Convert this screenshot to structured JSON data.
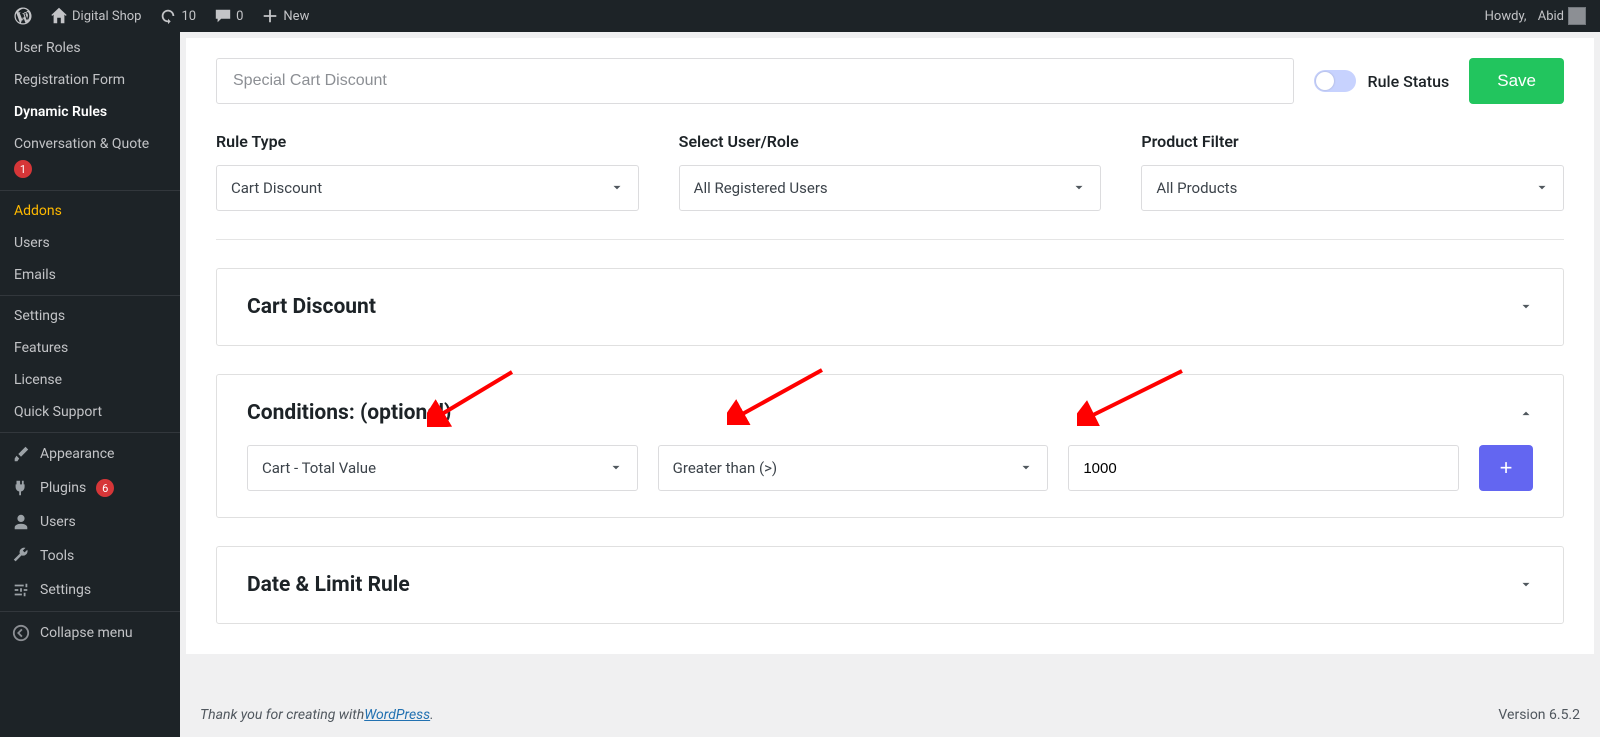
{
  "adminbar": {
    "site_name": "Digital Shop",
    "updates_count": "10",
    "comments_count": "0",
    "new_label": "New",
    "howdy_prefix": "Howdy,",
    "user": "Abid"
  },
  "sidebar": {
    "user_roles": "User Roles",
    "registration_form": "Registration Form",
    "dynamic_rules": "Dynamic Rules",
    "conversation_quote": "Conversation & Quote",
    "conversation_badge": "1",
    "addons": "Addons",
    "users": "Users",
    "emails": "Emails",
    "settings": "Settings",
    "features": "Features",
    "license": "License",
    "quick_support": "Quick Support",
    "appearance": "Appearance",
    "plugins": "Plugins",
    "plugins_badge": "6",
    "wp_users": "Users",
    "tools": "Tools",
    "wp_settings": "Settings",
    "collapse": "Collapse menu"
  },
  "main": {
    "rule_name_placeholder": "Special Cart Discount",
    "rule_status_label": "Rule Status",
    "save_label": "Save",
    "rule_type_label": "Rule Type",
    "rule_type_value": "Cart Discount",
    "user_role_label": "Select User/Role",
    "user_role_value": "All Registered Users",
    "product_filter_label": "Product Filter",
    "product_filter_value": "All Products",
    "section_cart_discount": "Cart Discount",
    "section_conditions": "Conditions: (optional)",
    "cond_field_value": "Cart - Total Value",
    "cond_op_value": "Greater than (>)",
    "cond_value": "1000",
    "section_date_limit": "Date & Limit Rule"
  },
  "footer": {
    "text": "Thank you for creating with ",
    "link": "WordPress",
    "suffix": ".",
    "version": "Version 6.5.2"
  }
}
